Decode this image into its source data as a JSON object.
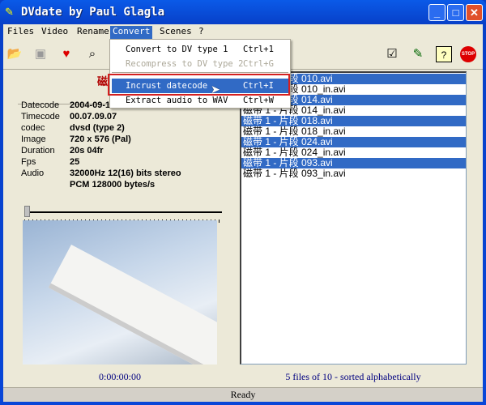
{
  "window": {
    "title": "DVdate by Paul Glagla",
    "minimize": "_",
    "maximize": "□",
    "close": "✕"
  },
  "menu": [
    "Files",
    "Video",
    "Rename",
    "Convert",
    "Scenes",
    "?"
  ],
  "convert_menu": [
    {
      "label": "Convert to DV type 1",
      "shortcut": "Ctrl+1",
      "disabled": false
    },
    {
      "label": "Recompress to DV type 2",
      "shortcut": "Ctrl+G",
      "disabled": true
    },
    {
      "label": "Incrust datecode",
      "shortcut": "Ctrl+I",
      "highlighted": true
    },
    {
      "label": "Extract audio to WAV",
      "shortcut": "Ctrl+W"
    }
  ],
  "toolbar_icons": [
    "open-folder-icon",
    "save-icon",
    "favorite-icon",
    "find-icon",
    "check-icon",
    "edit-icon",
    "help-icon",
    "stop-icon"
  ],
  "banner": "磁",
  "info": [
    {
      "k": "Datecode",
      "v": "2004-09-1"
    },
    {
      "k": "Timecode",
      "v": "00.07.09.07"
    },
    {
      "k": "codec",
      "v": "dvsd (type 2)"
    },
    {
      "k": "Image",
      "v": "720 x 576 (Pal)"
    },
    {
      "k": "Duration",
      "v": "20s 04fr"
    },
    {
      "k": "Fps",
      "v": "25"
    },
    {
      "k": "Audio",
      "v": "32000Hz 12(16) bits  stereo"
    },
    {
      "k": "",
      "v": "PCM 128000 bytes/s"
    }
  ],
  "timecode": "0:00:00:00",
  "files": [
    {
      "name": "磁带 1 - 片段 010.avi",
      "selected": true
    },
    {
      "name": "磁带 1 - 片段 010_in.avi",
      "selected": false
    },
    {
      "name": "磁带 1 - 片段 014.avi",
      "selected": true
    },
    {
      "name": "磁带 1 - 片段 014_in.avi",
      "selected": false
    },
    {
      "name": "磁带 1 - 片段 018.avi",
      "selected": true
    },
    {
      "name": "磁带 1 - 片段 018_in.avi",
      "selected": false
    },
    {
      "name": "磁带 1 - 片段 024.avi",
      "selected": true
    },
    {
      "name": "磁带 1 - 片段 024_in.avi",
      "selected": false
    },
    {
      "name": "磁带 1 - 片段 093.avi",
      "selected": true
    },
    {
      "name": "磁带 1 - 片段 093_in.avi",
      "selected": false
    }
  ],
  "file_count": "5 files of 10 - sorted alphabetically",
  "status": "Ready"
}
